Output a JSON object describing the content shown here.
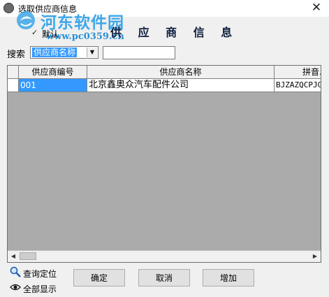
{
  "window": {
    "title": "选取供应商信息"
  },
  "watermark": {
    "name": "河东软件园",
    "url": "www.pc0359.cn"
  },
  "options": {
    "default_label": "默认",
    "default_checked": true
  },
  "heading": "供 应 商 信 息",
  "search": {
    "label": "搜索",
    "field_selected": "供应商名称",
    "query": ""
  },
  "grid": {
    "columns": [
      "供应商编号",
      "供应商名称",
      "拼音..."
    ],
    "rows": [
      {
        "code": "001",
        "name": "北京鑫奥众汽车配件公司",
        "pinyin": "BJZAZQCPJGS"
      }
    ]
  },
  "actions": {
    "locate_label": "查询定位",
    "show_all_label": "全部显示",
    "ok_label": "确定",
    "cancel_label": "取消",
    "add_label": "增加"
  },
  "colors": {
    "selection": "#3399ff",
    "grid_bg": "#ababab",
    "watermark": "#3da7e8"
  },
  "icons": {
    "close": "close-icon",
    "locate": "search-icon",
    "show_all": "eye-icon",
    "app": "app-icon"
  }
}
